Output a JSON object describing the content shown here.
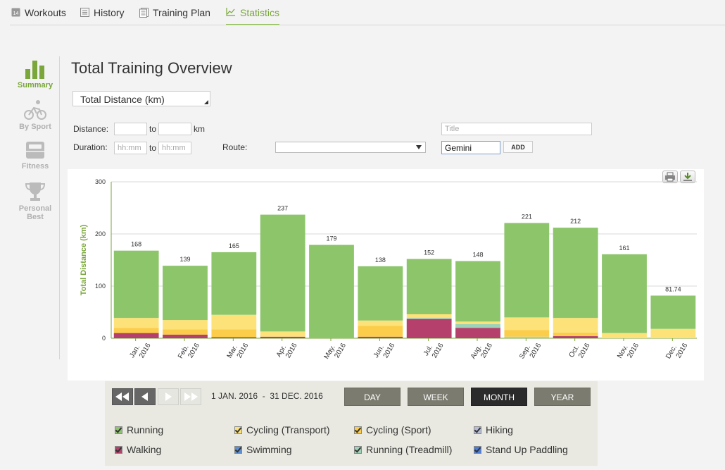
{
  "nav": {
    "tabs": [
      {
        "label": "Workouts",
        "badge": "14"
      },
      {
        "label": "History"
      },
      {
        "label": "Training Plan"
      },
      {
        "label": "Statistics"
      }
    ]
  },
  "sidebar": {
    "items": [
      {
        "label": "Summary"
      },
      {
        "label": "By Sport"
      },
      {
        "label": "Fitness"
      },
      {
        "label": "Personal Best"
      }
    ]
  },
  "page": {
    "title": "Total Training Overview"
  },
  "metric_select": {
    "value": "Total Distance (km)"
  },
  "filters": {
    "distance_label": "Distance:",
    "to1": "to",
    "km": "km",
    "duration_label": "Duration:",
    "to2": "to",
    "duration_placeholder": "hh:mm",
    "route_label": "Route:",
    "title_placeholder": "Title",
    "tag_value": "Gemini",
    "add_label": "ADD"
  },
  "chart_data": {
    "type": "bar",
    "ylabel": "Total Distance (km)",
    "ylim": [
      0,
      300
    ],
    "yticks": [
      "0",
      "100",
      "200",
      "300"
    ],
    "categories": [
      [
        "Jan.",
        "2016"
      ],
      [
        "Feb.",
        "2016"
      ],
      [
        "Mar.",
        "2016"
      ],
      [
        "Apr.",
        "2016"
      ],
      [
        "May.",
        "2016"
      ],
      [
        "Jun.",
        "2016"
      ],
      [
        "Jul.",
        "2016"
      ],
      [
        "Aug.",
        "2016"
      ],
      [
        "Sep.",
        "2016"
      ],
      [
        "Oct.",
        "2016"
      ],
      [
        "Nov.",
        "2016"
      ],
      [
        "Dec.",
        "2016"
      ]
    ],
    "totals": [
      168,
      139,
      165,
      237,
      179,
      138,
      152,
      148,
      221,
      212,
      161,
      81.74
    ],
    "total_labels": [
      "168",
      "139",
      "165",
      "237",
      "179",
      "138",
      "152",
      "148",
      "221",
      "212",
      "161",
      "81.74"
    ],
    "series": [
      {
        "name": "Walking",
        "color": "#b5406b",
        "values": [
          10,
          7,
          2,
          3,
          0,
          3,
          37,
          20,
          0,
          4,
          0,
          0
        ]
      },
      {
        "name": "Running (Treadmill)",
        "color": "#9fd3b8",
        "values": [
          0,
          0,
          0,
          0,
          0,
          0,
          2,
          7,
          3,
          0,
          0,
          0
        ]
      },
      {
        "name": "Cycling (Sport)",
        "color": "#fccd4a",
        "values": [
          10,
          10,
          15,
          0,
          0,
          21,
          0,
          0,
          13,
          7,
          0,
          0
        ]
      },
      {
        "name": "Cycling (Transport)",
        "color": "#fde27a",
        "values": [
          19,
          18,
          28,
          10,
          0,
          10,
          7,
          5,
          24,
          28,
          10,
          18
        ]
      },
      {
        "name": "Running",
        "color": "#8cc56a",
        "values": [
          129,
          104,
          120,
          224,
          179,
          104,
          106,
          116,
          181,
          173,
          151,
          63.74
        ]
      }
    ]
  },
  "controls": {
    "date_range": "1 JAN. 2016  -  31 DEC. 2016",
    "periods": [
      "DAY",
      "WEEK",
      "MONTH",
      "YEAR"
    ],
    "active_period": "MONTH"
  },
  "legend": [
    {
      "label": "Running",
      "color": "#8cc56a"
    },
    {
      "label": "Cycling (Transport)",
      "color": "#fde27a"
    },
    {
      "label": "Cycling (Sport)",
      "color": "#fccd4a"
    },
    {
      "label": "Hiking",
      "color": "#b6bcd8"
    },
    {
      "label": "Walking",
      "color": "#b5406b"
    },
    {
      "label": "Swimming",
      "color": "#5b8fd8"
    },
    {
      "label": "Running (Treadmill)",
      "color": "#9fd3b8"
    },
    {
      "label": "Stand Up Paddling",
      "color": "#4a7fe0"
    }
  ]
}
